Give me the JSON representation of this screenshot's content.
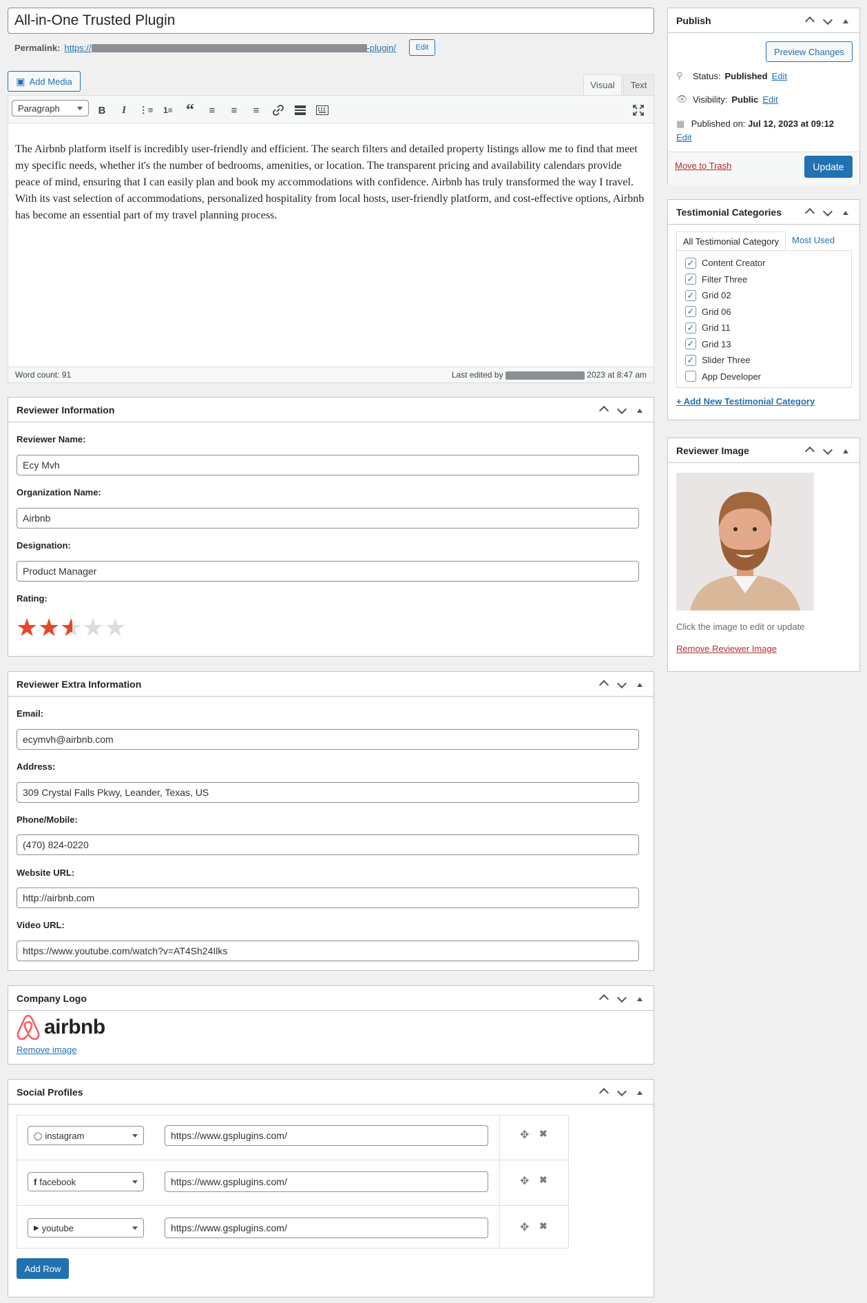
{
  "post": {
    "title": "All-in-One Trusted Plugin",
    "permalink_label": "Permalink:",
    "permalink_prefix": "https://",
    "permalink_suffix": "-plugin/",
    "permalink_edit": "Edit"
  },
  "editor": {
    "add_media": "Add Media",
    "tab_visual": "Visual",
    "tab_text": "Text",
    "format_select": "Paragraph",
    "content": "The Airbnb platform itself is incredibly user-friendly and efficient. The search filters and detailed property listings allow me to find  that meet my specific needs, whether it's the number of bedrooms, amenities, or location. The transparent pricing and availability calendars provide peace of mind, ensuring that I can easily plan and book my accommodations with confidence. Airbnb has truly transformed the way I travel. With its vast selection of accommodations, personalized hospitality from local hosts, user-friendly platform, and cost-effective options, Airbnb has become an essential part of my travel planning process.",
    "word_count": "Word count: 91",
    "last_edited_prefix": "Last edited by",
    "last_edited_suffix": "2023 at 8:47 am"
  },
  "reviewer_info": {
    "title": "Reviewer Information",
    "name_label": "Reviewer Name:",
    "name_value": "Ecy Mvh",
    "org_label": "Organization Name:",
    "org_value": "Airbnb",
    "designation_label": "Designation:",
    "designation_value": "Product Manager",
    "rating_label": "Rating:",
    "rating_value": 2.5,
    "rating_max": 5
  },
  "reviewer_extra": {
    "title": "Reviewer Extra Information",
    "email_label": "Email:",
    "email_value": "ecymvh@airbnb.com",
    "address_label": "Address:",
    "address_value": "309 Crystal Falls Pkwy, Leander, Texas, US",
    "phone_label": "Phone/Mobile:",
    "phone_value": "(470) 824-0220",
    "website_label": "Website URL:",
    "website_value": "http://airbnb.com",
    "video_label": "Video URL:",
    "video_value": "https://www.youtube.com/watch?v=AT4Sh24Ilks"
  },
  "company_logo": {
    "title": "Company Logo",
    "logo_text": "airbnb",
    "remove": "Remove image"
  },
  "social": {
    "title": "Social Profiles",
    "rows": [
      {
        "network": "instagram",
        "icon": "instagram-icon",
        "url": "https://www.gsplugins.com/"
      },
      {
        "network": "facebook",
        "icon": "facebook-icon",
        "url": "https://www.gsplugins.com/"
      },
      {
        "network": "youtube",
        "icon": "youtube-icon",
        "url": "https://www.gsplugins.com/"
      }
    ],
    "add_row": "Add Row"
  },
  "publish": {
    "title": "Publish",
    "preview": "Preview Changes",
    "status_label": "Status:",
    "status_value": "Published",
    "visibility_label": "Visibility:",
    "visibility_value": "Public",
    "published_label": "Published on:",
    "published_value": "Jul 12, 2023 at 09:12",
    "edit": "Edit",
    "trash": "Move to Trash",
    "update": "Update"
  },
  "categories": {
    "title": "Testimonial Categories",
    "tab_all": "All Testimonial Category",
    "tab_used": "Most Used",
    "items": [
      {
        "label": "Content Creator",
        "checked": true
      },
      {
        "label": "Filter Three",
        "checked": true
      },
      {
        "label": "Grid 02",
        "checked": true
      },
      {
        "label": "Grid 06",
        "checked": true
      },
      {
        "label": "Grid 11",
        "checked": true
      },
      {
        "label": "Grid 13",
        "checked": true
      },
      {
        "label": "Slider Three",
        "checked": true
      },
      {
        "label": "App Developer",
        "checked": false
      }
    ],
    "add_new": "+ Add New Testimonial Category"
  },
  "reviewer_image": {
    "title": "Reviewer Image",
    "hint": "Click the image to edit or update",
    "remove": "Remove Reviewer Image"
  },
  "colors": {
    "primary": "#2271b1",
    "star": "#e8462a",
    "trash": "#b32d2e",
    "logo": "#ff5a5f"
  }
}
